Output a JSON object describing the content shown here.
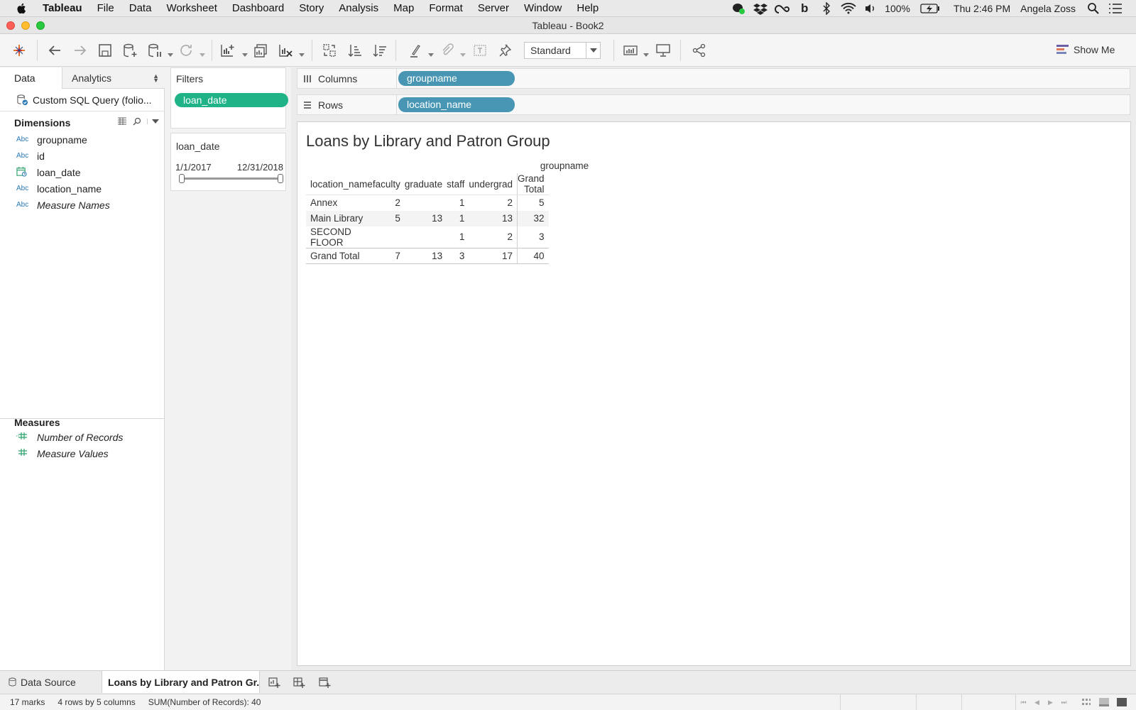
{
  "menubar": {
    "app_name": "Tableau",
    "items": [
      "File",
      "Data",
      "Worksheet",
      "Dashboard",
      "Story",
      "Analysis",
      "Map",
      "Format",
      "Server",
      "Window",
      "Help"
    ],
    "battery": "100%",
    "clock": "Thu 2:46 PM",
    "user": "Angela Zoss"
  },
  "window": {
    "title": "Tableau - Book2"
  },
  "toolbar": {
    "mark_size_select": "Standard",
    "show_me_label": "Show Me"
  },
  "data_pane": {
    "tab_data": "Data",
    "tab_analytics": "Analytics",
    "datasource_label": "Custom SQL Query (folio...",
    "dimensions_heading": "Dimensions",
    "dimensions": [
      {
        "type": "Abc",
        "name": "groupname",
        "icon": "string-type-icon"
      },
      {
        "type": "Abc",
        "name": "id",
        "icon": "string-type-icon"
      },
      {
        "type": "",
        "name": "loan_date",
        "icon": "date-type-icon"
      },
      {
        "type": "Abc",
        "name": "location_name",
        "icon": "string-type-icon"
      },
      {
        "type": "Abc",
        "name": "Measure Names",
        "icon": "string-type-icon"
      }
    ],
    "measures_heading": "Measures",
    "measures": [
      {
        "name": "Number of Records"
      },
      {
        "name": "Measure Values"
      }
    ]
  },
  "filters": {
    "heading": "Filters",
    "pill": "loan_date"
  },
  "quick_filter": {
    "title": "loan_date",
    "range_start": "1/1/2017",
    "range_end": "12/31/2018"
  },
  "shelves": {
    "columns_label": "Columns",
    "columns_pill": "groupname",
    "rows_label": "Rows",
    "rows_pill": "location_name"
  },
  "view": {
    "title": "Loans by Library and Patron Group",
    "column_header": "groupname",
    "row_header": "location_name",
    "columns": [
      "faculty",
      "graduate",
      "staff",
      "undergrad",
      "Grand Total"
    ],
    "rows": [
      {
        "label": "Annex",
        "values": [
          "2",
          "",
          "1",
          "2",
          "5"
        ]
      },
      {
        "label": "Main Library",
        "values": [
          "5",
          "13",
          "1",
          "13",
          "32"
        ]
      },
      {
        "label": "SECOND FLOOR",
        "values": [
          "",
          "",
          "1",
          "2",
          "3"
        ]
      }
    ],
    "total_row": {
      "label": "Grand Total",
      "values": [
        "7",
        "13",
        "3",
        "17",
        "40"
      ]
    }
  },
  "sheet_tabs": {
    "datasource": "Data Source",
    "sheet": "Loans by Library and Patron Gr..."
  },
  "statusbar": {
    "marks": "17 marks",
    "dims": "4 rows by 5 columns",
    "sum": "SUM(Number of Records): 40"
  },
  "colors": {
    "filter_pill": "#1fb387",
    "dimension_pill": "#4896b3",
    "type_icon": "#2c7bb6",
    "measure_icon": "#2ca26b"
  }
}
